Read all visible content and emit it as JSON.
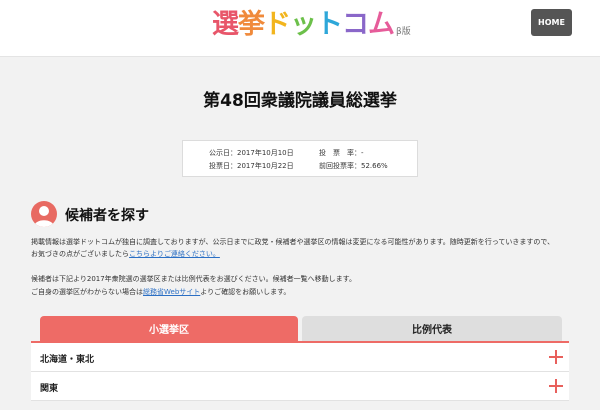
{
  "header": {
    "logo_chars": [
      "選",
      "挙",
      "ド",
      "ッ",
      "ト",
      "コ",
      "ム"
    ],
    "logo_beta": "β版",
    "home_label": "HOME",
    "home_color": "#555555"
  },
  "page_title": "第48回衆議院議員総選挙",
  "dates": {
    "announce_label": "公示日：",
    "announce_value": "2017年10月10日",
    "vote_day_label": "投票日：",
    "vote_day_value": "2017年10月22日",
    "turnout_label": "投　票　率：",
    "turnout_value": "-",
    "prev_turnout_label": "前回投票率：",
    "prev_turnout_value": "52.66%"
  },
  "section": {
    "icon": "person-icon",
    "title": "候補者を探す",
    "notice_line1": "掲載情報は選挙ドットコムが独自に調査しておりますが、公示日までに政党・候補者や選挙区の情報は変更になる可能性があります。随時更新を行っていきますので、",
    "notice_line2_prefix": "お気づきの点がございましたら",
    "notice_link": "こちらよりご連絡ください。",
    "instruction_line1": "候補者は下記より2017年衆院選の選挙区または比例代表をお選びください。候補者一覧へ移動します。",
    "instruction_line2_prefix": "ご自身の選挙区がわからない場合は",
    "instruction_link": "総務省Webサイト",
    "instruction_line2_suffix": "よりご確認をお願いします。"
  },
  "tabs": [
    {
      "label": "小選挙区",
      "active": true
    },
    {
      "label": "比例代表",
      "active": false
    }
  ],
  "regions": [
    {
      "label": "北海道・東北"
    },
    {
      "label": "関東"
    }
  ],
  "colors": {
    "accent": "#ee6b66",
    "link": "#2b6fc4"
  }
}
